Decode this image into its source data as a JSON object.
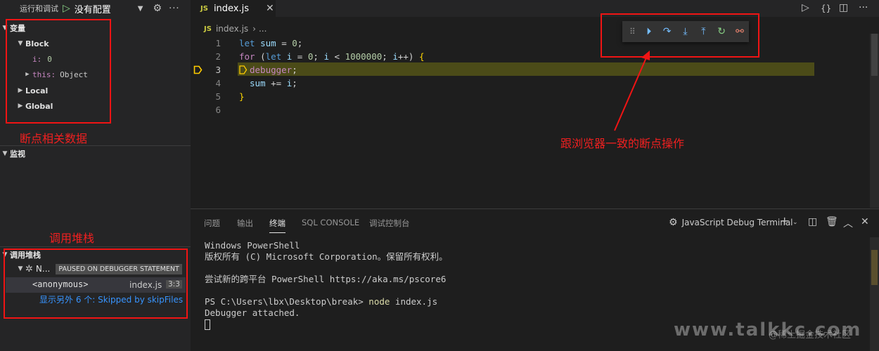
{
  "sidebar": {
    "title": "运行和调试",
    "config": "没有配置",
    "variables": {
      "heading": "变量",
      "block": "Block",
      "i_name": "i:",
      "i_value": "0",
      "this_name": "this:",
      "this_value": "Object",
      "local": "Local",
      "global": "Global"
    },
    "watch": {
      "heading": "监视"
    },
    "callstack": {
      "heading": "调用堆栈",
      "thread_name": "N...",
      "paused_badge": "PAUSED ON DEBUGGER STATEMENT",
      "frame_name": "<anonymous>",
      "frame_file": "index.js",
      "frame_pos": "3:3",
      "more_frames": "显示另外 6 个: Skipped by skipFiles"
    }
  },
  "annotations": {
    "variables": "断点相关数据",
    "callstack": "调用堆栈",
    "toolbar": "跟浏览器一致的断点操作"
  },
  "editor": {
    "tab_badge": "JS",
    "tab_name": "index.js",
    "breadcrumb_file": "index.js",
    "breadcrumb_more": "...",
    "lines": [
      {
        "n": "1"
      },
      {
        "n": "2"
      },
      {
        "n": "3"
      },
      {
        "n": "4"
      },
      {
        "n": "5"
      },
      {
        "n": "6"
      }
    ],
    "code": {
      "l1_kw": "let",
      "l1_var": "sum",
      "l1_rest": " = ",
      "l1_num": "0",
      "l1_end": ";",
      "l2_kw": "for",
      "l2_a": " (",
      "l2_let": "let",
      "l2_i": " i",
      "l2_eq": " = ",
      "l2_zero": "0",
      "l2_b": "; ",
      "l2_i2": "i",
      "l2_lt": " < ",
      "l2_max": "1000000",
      "l2_c": "; ",
      "l2_i3": "i",
      "l2_d": "++) ",
      "l2_brace": "{",
      "l3_kw": "debugger",
      "l3_end": ";",
      "l4_var": "sum",
      "l4_op": " += ",
      "l4_i": "i",
      "l4_end": ";",
      "l5_brace": "}"
    }
  },
  "panel": {
    "tabs": [
      "问题",
      "输出",
      "终端",
      "SQL CONSOLE",
      "调试控制台"
    ],
    "active_tab": "终端",
    "terminal_name": "JavaScript Debug Terminal",
    "terminal": {
      "l1": "Windows PowerShell",
      "l2": "版权所有 (C) Microsoft Corporation。保留所有权利。",
      "l3": "尝试新的跨平台 PowerShell https://aka.ms/pscore6",
      "prompt": "PS C:\\Users\\lbx\\Desktop\\break> ",
      "cmd": "node",
      "args": " index.js",
      "l5": "Debugger attached."
    }
  },
  "watermark": {
    "site": "www.talkkc.com",
    "author": "@稀土掘金技术社区"
  },
  "colors": {
    "accent_red": "#f01414",
    "debug_blue": "#75beff",
    "debug_green": "#89d185",
    "debug_stop": "#f48771"
  }
}
